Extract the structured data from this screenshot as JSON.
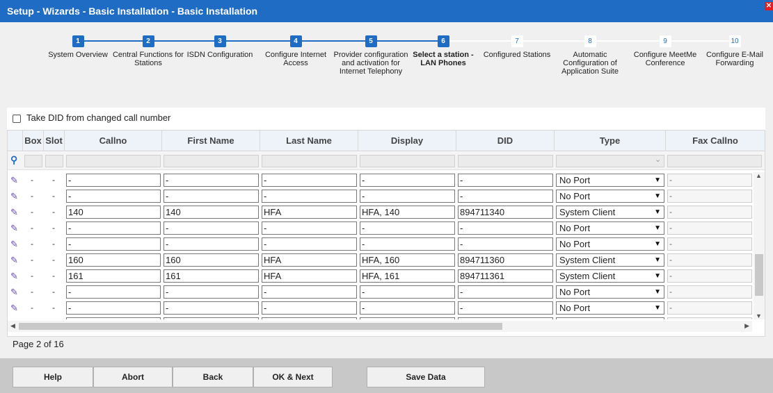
{
  "window": {
    "title": "Setup - Wizards - Basic Installation - Basic Installation"
  },
  "steps": [
    {
      "num": "1",
      "label": "System Overview",
      "state": "done"
    },
    {
      "num": "2",
      "label": "Central Functions for Stations",
      "state": "done"
    },
    {
      "num": "3",
      "label": "ISDN Configuration",
      "state": "done"
    },
    {
      "num": "4",
      "label": "Configure Internet Access",
      "state": "done"
    },
    {
      "num": "5",
      "label": "Provider configuration and activation for Internet Telephony",
      "state": "done"
    },
    {
      "num": "6",
      "label": "Select a station - LAN Phones",
      "state": "current"
    },
    {
      "num": "7",
      "label": "Configured Stations",
      "state": "todo"
    },
    {
      "num": "8",
      "label": "Automatic Configuration of Application Suite",
      "state": "todo"
    },
    {
      "num": "9",
      "label": "Configure MeetMe Conference",
      "state": "todo"
    },
    {
      "num": "10",
      "label": "Configure E-Mail Forwarding",
      "state": "todo"
    }
  ],
  "did_option": {
    "label": "Take DID from changed call number",
    "checked": false
  },
  "table": {
    "columns": [
      "Box",
      "Slot",
      "Callno",
      "First Name",
      "Last Name",
      "Display",
      "DID",
      "Type",
      "Fax Callno"
    ],
    "rows": [
      {
        "box": "-",
        "slot": "-",
        "callno": "-",
        "first": "-",
        "last": "-",
        "display": "-",
        "did": "-",
        "type": "No Port",
        "fax": "-"
      },
      {
        "box": "-",
        "slot": "-",
        "callno": "-",
        "first": "-",
        "last": "-",
        "display": "-",
        "did": "-",
        "type": "No Port",
        "fax": "-"
      },
      {
        "box": "-",
        "slot": "-",
        "callno": "140",
        "first": "140",
        "last": "HFA",
        "display": "HFA, 140",
        "did": "894711340",
        "type": "System Client",
        "fax": "-"
      },
      {
        "box": "-",
        "slot": "-",
        "callno": "-",
        "first": "-",
        "last": "-",
        "display": "-",
        "did": "-",
        "type": "No Port",
        "fax": "-"
      },
      {
        "box": "-",
        "slot": "-",
        "callno": "-",
        "first": "-",
        "last": "-",
        "display": "-",
        "did": "-",
        "type": "No Port",
        "fax": "-"
      },
      {
        "box": "-",
        "slot": "-",
        "callno": "160",
        "first": "160",
        "last": "HFA",
        "display": "HFA, 160",
        "did": "894711360",
        "type": "System Client",
        "fax": "-"
      },
      {
        "box": "-",
        "slot": "-",
        "callno": "161",
        "first": "161",
        "last": "HFA",
        "display": "HFA, 161",
        "did": "894711361",
        "type": "System Client",
        "fax": "-"
      },
      {
        "box": "-",
        "slot": "-",
        "callno": "-",
        "first": "-",
        "last": "-",
        "display": "-",
        "did": "-",
        "type": "No Port",
        "fax": "-"
      },
      {
        "box": "-",
        "slot": "-",
        "callno": "-",
        "first": "-",
        "last": "-",
        "display": "-",
        "did": "-",
        "type": "No Port",
        "fax": "-"
      },
      {
        "box": "-",
        "slot": "-",
        "callno": "-",
        "first": "-",
        "last": "-",
        "display": "-",
        "did": "-",
        "type": "",
        "fax": "-"
      }
    ]
  },
  "pagination": {
    "text": "Page 2 of 16"
  },
  "buttons": {
    "help": "Help",
    "abort": "Abort",
    "back": "Back",
    "ok_next": "OK & Next",
    "save": "Save Data"
  },
  "colors": {
    "accent": "#1f6cc4",
    "close": "#e02020"
  }
}
